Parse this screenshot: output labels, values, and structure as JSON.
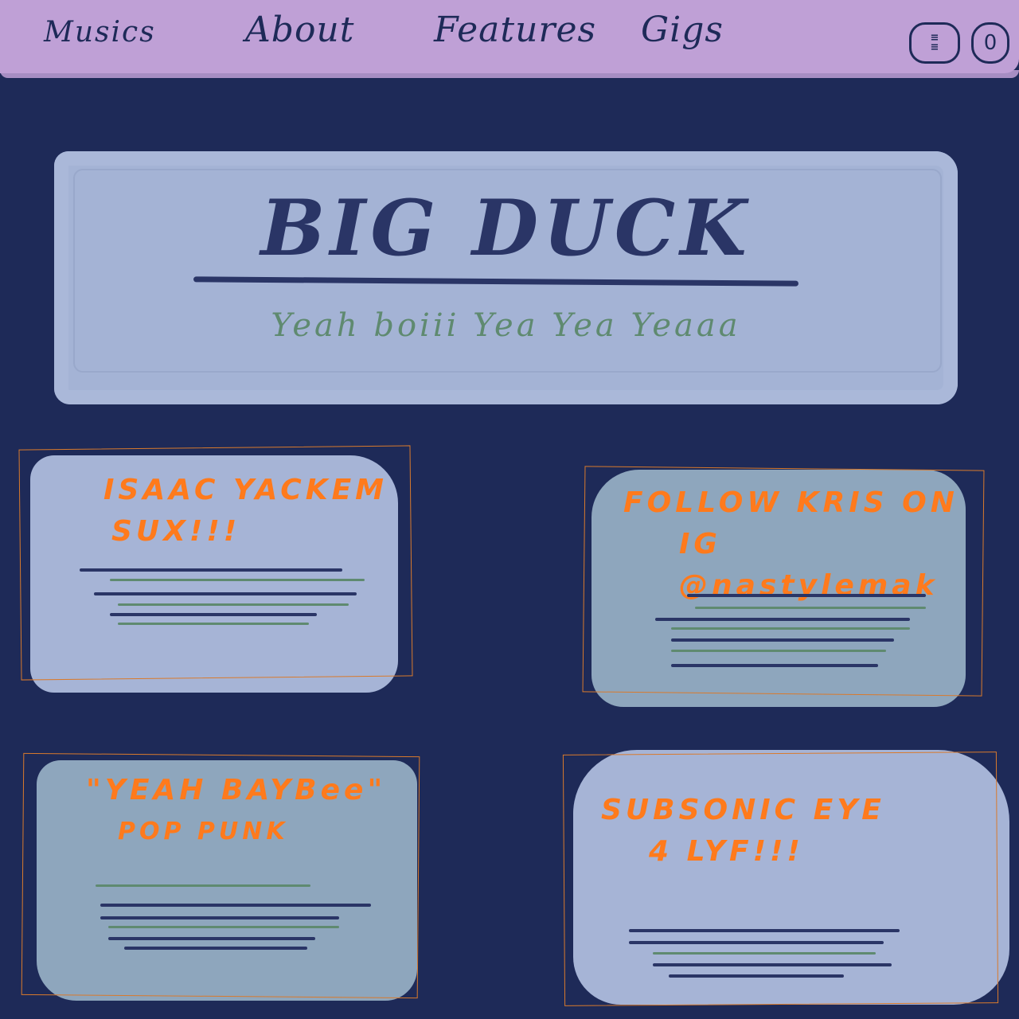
{
  "nav": {
    "items": [
      {
        "label": "Musics"
      },
      {
        "label": "About"
      },
      {
        "label": "Features"
      },
      {
        "label": "Gigs"
      }
    ],
    "cart_count": "0",
    "menu_icon": "menu-icon",
    "cart_icon": "cart-icon"
  },
  "hero": {
    "title": "BIG DUCK",
    "subtitle": "Yeah boiii Yea Yea Yeaaa"
  },
  "cards": [
    {
      "line1": "ISAAC YACKEM",
      "line2": "SUX!!!"
    },
    {
      "line1": "FOLLOW KRIS ON",
      "line2": "IG @nastylemak"
    },
    {
      "line1": "\"YEAH BAYBee\"",
      "line2": "POP PUNK"
    },
    {
      "line1": "SUBSONIC EYE",
      "line2": "4 LYF!!!"
    }
  ],
  "colors": {
    "background": "#1e2a58",
    "navbar": "#bfa0d6",
    "card_light": "#a6b4d6",
    "card_teal": "#8ea6bd",
    "accent_orange": "#ff7a1c",
    "accent_green": "#5f8a70"
  }
}
